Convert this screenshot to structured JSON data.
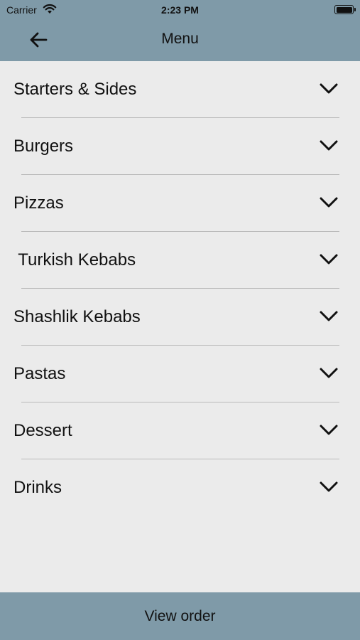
{
  "status_bar": {
    "carrier": "Carrier",
    "time": "2:23 PM",
    "wifi_icon": "wifi-icon",
    "battery_icon": "battery-icon"
  },
  "nav": {
    "title": "Menu",
    "back_icon": "arrow-left-icon"
  },
  "categories": [
    {
      "label": "Starters & Sides"
    },
    {
      "label": "Burgers"
    },
    {
      "label": "Pizzas"
    },
    {
      "label": " Turkish Kebabs"
    },
    {
      "label": "Shashlik Kebabs"
    },
    {
      "label": "Pastas"
    },
    {
      "label": "Dessert"
    },
    {
      "label": "Drinks"
    }
  ],
  "footer": {
    "label": "View order"
  },
  "colors": {
    "bar": "#7f9aa8",
    "background": "#ebebeb",
    "separator": "#b9b9b9"
  }
}
